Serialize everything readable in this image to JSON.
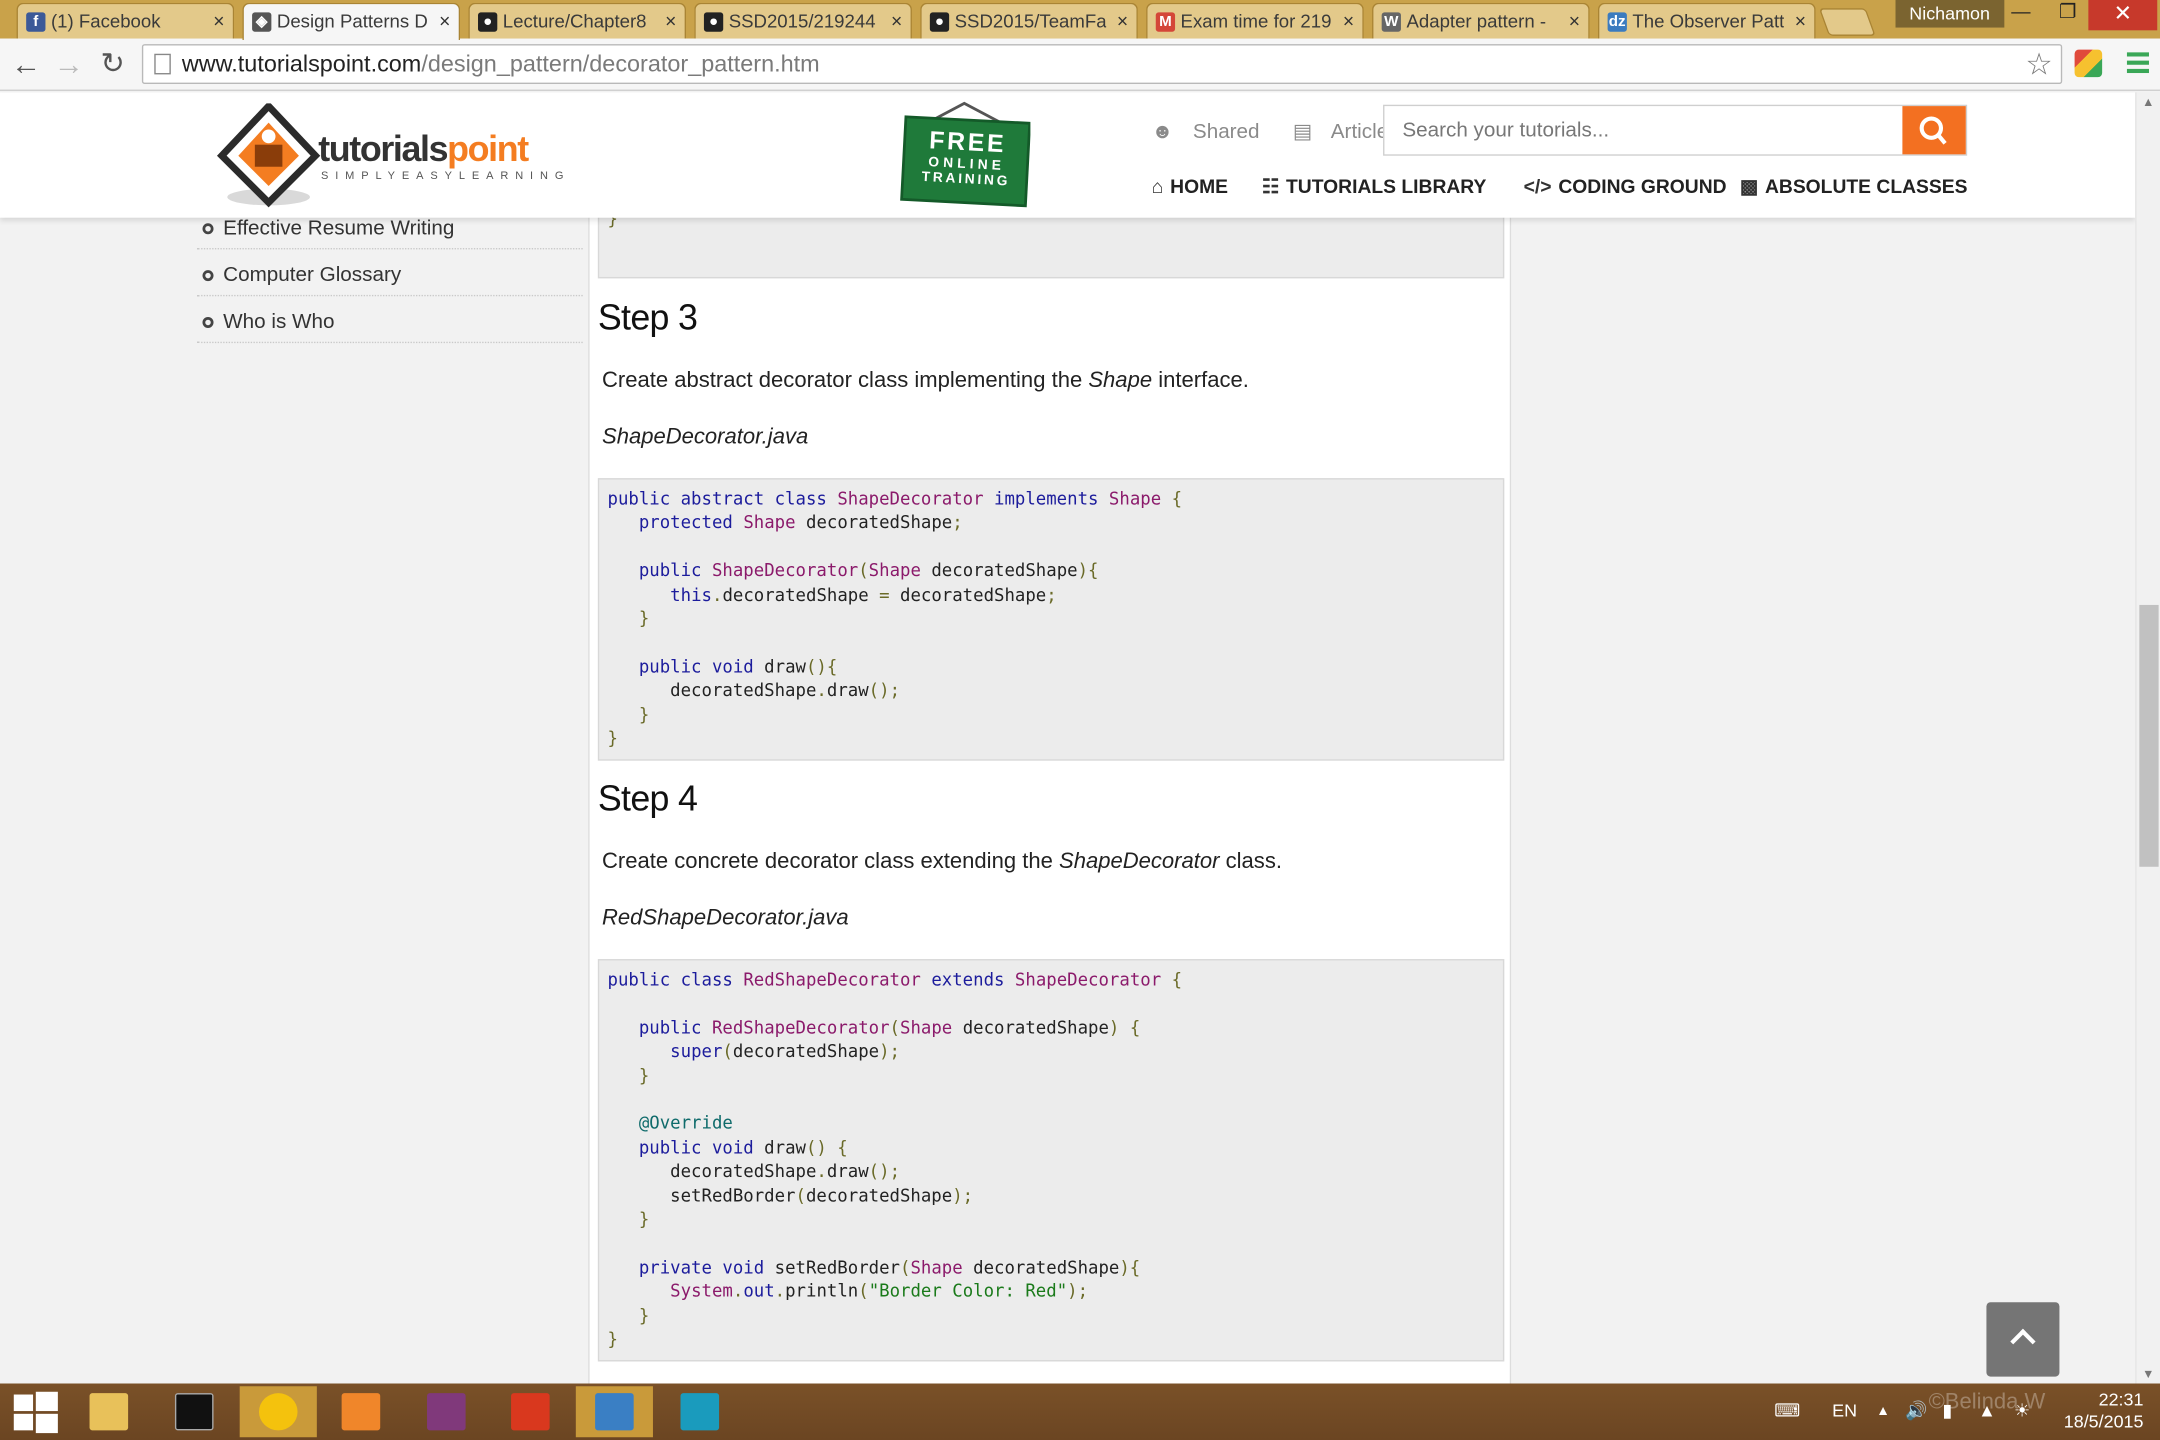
{
  "browser": {
    "tabs": [
      {
        "label": "(1) Facebook",
        "icon": "facebook-icon",
        "color": "#3b5998",
        "glyph": "f"
      },
      {
        "label": "Design Patterns D",
        "icon": "tutorialspoint-icon",
        "color": "#555555",
        "glyph": "◈"
      },
      {
        "label": "Lecture/Chapter8",
        "icon": "github-icon",
        "color": "#222222",
        "glyph": "●"
      },
      {
        "label": "SSD2015/219244",
        "icon": "github-icon",
        "color": "#222222",
        "glyph": "●"
      },
      {
        "label": "SSD2015/TeamFa",
        "icon": "github-icon",
        "color": "#222222",
        "glyph": "●"
      },
      {
        "label": "Exam time for 219",
        "icon": "gmail-icon",
        "color": "#d44638",
        "glyph": "M"
      },
      {
        "label": "Adapter pattern -",
        "icon": "wikipedia-icon",
        "color": "#666666",
        "glyph": "W"
      },
      {
        "label": "The Observer Patt",
        "icon": "dzone-icon",
        "color": "#3b7bbf",
        "glyph": "dz"
      }
    ],
    "user": "Nichamon",
    "url_domain": "www.tutorialspoint.com",
    "url_path": "/design_pattern/decorator_pattern.htm"
  },
  "header": {
    "logo_main": "tutorials",
    "logo_accent": "point",
    "logo_tagline": "SIMPLYEASYLEARNING",
    "badge": [
      "FREE",
      "ONLINE",
      "TRAINING"
    ],
    "links": {
      "shared": "Shared",
      "articles": "Articles"
    },
    "search_placeholder": "Search your tutorials...",
    "nav": {
      "home": "HOME",
      "library": "TUTORIALS LIBRARY",
      "coding": "CODING GROUND",
      "classes": "ABSOLUTE CLASSES"
    }
  },
  "sidebar": {
    "items": [
      "Effective Resume Writing",
      "Computer Glossary",
      "Who is Who"
    ]
  },
  "content": {
    "step3": {
      "heading": "Step 3",
      "text_before": "Create abstract decorator class implementing the ",
      "text_em": "Shape",
      "text_after": " interface.",
      "filename": "ShapeDecorator.java"
    },
    "step4": {
      "heading": "Step 4",
      "text_before": "Create concrete decorator class extending the ",
      "text_em": "ShapeDecorator",
      "text_after": " class.",
      "filename": "RedShapeDecorator.java"
    }
  },
  "taskbar": {
    "lang": "EN",
    "time": "22:31",
    "date": "18/5/2015",
    "watermark": "©Belinda W"
  }
}
